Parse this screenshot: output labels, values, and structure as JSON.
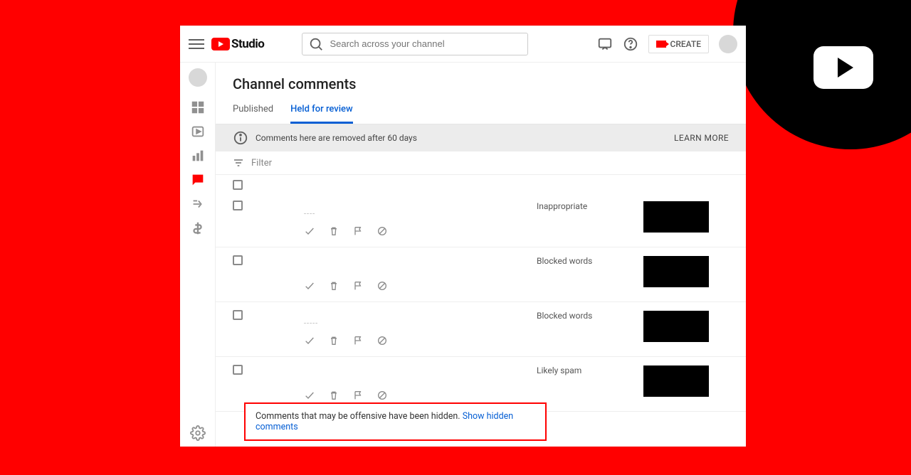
{
  "brand": {
    "name": "Studio"
  },
  "header": {
    "search_placeholder": "Search across your channel",
    "create_label": "CREATE"
  },
  "page": {
    "title": "Channel comments",
    "tabs": [
      {
        "id": "published",
        "label": "Published",
        "active": false
      },
      {
        "id": "held",
        "label": "Held for review",
        "active": true
      }
    ],
    "infobar": {
      "text": "Comments here are removed after 60 days",
      "learn_more": "LEARN MORE"
    },
    "filter_label": "Filter",
    "comments": [
      {
        "reason": "Inappropriate",
        "placeholder": "----"
      },
      {
        "reason": "Blocked words",
        "placeholder": ""
      },
      {
        "reason": "Blocked words",
        "placeholder": "-----"
      },
      {
        "reason": "Likely spam",
        "placeholder": ""
      }
    ],
    "hidden_notice": {
      "text": "Comments that may be offensive have been hidden. ",
      "link": "Show hidden comments"
    }
  }
}
